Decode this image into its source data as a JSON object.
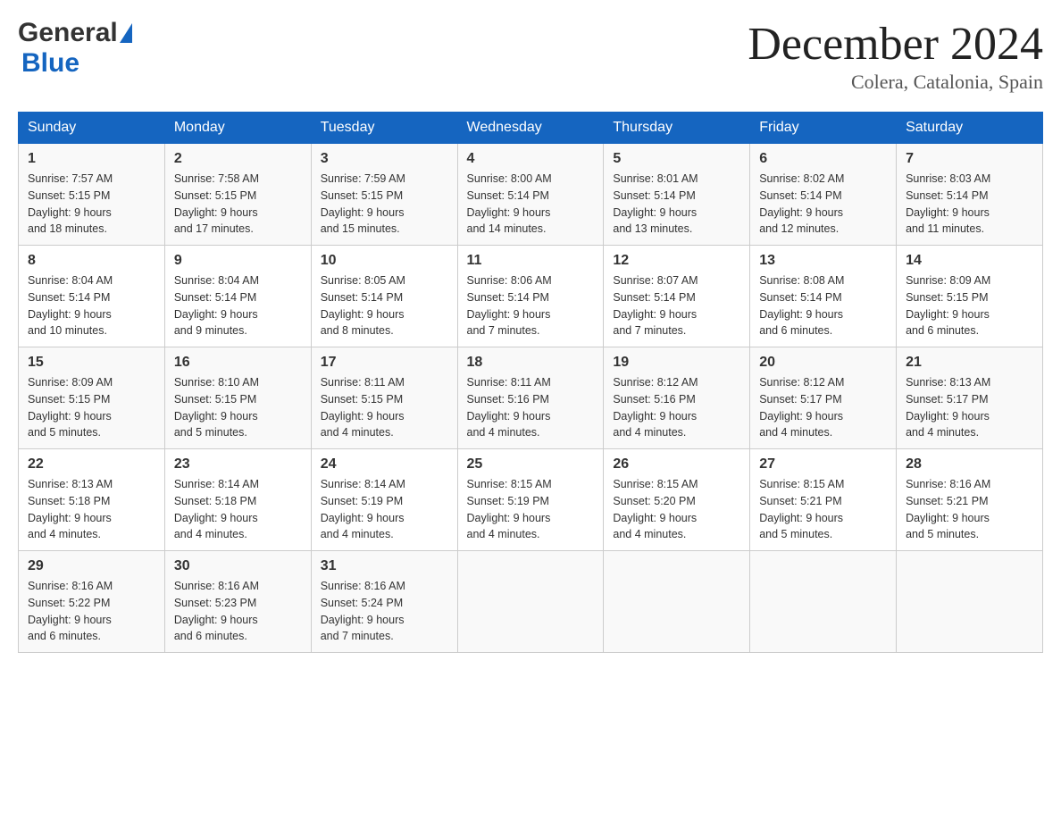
{
  "header": {
    "month_year": "December 2024",
    "location": "Colera, Catalonia, Spain",
    "logo_general": "General",
    "logo_blue": "Blue"
  },
  "days_of_week": [
    "Sunday",
    "Monday",
    "Tuesday",
    "Wednesday",
    "Thursday",
    "Friday",
    "Saturday"
  ],
  "weeks": [
    [
      {
        "day": "1",
        "sunrise": "7:57 AM",
        "sunset": "5:15 PM",
        "daylight": "9 hours and 18 minutes."
      },
      {
        "day": "2",
        "sunrise": "7:58 AM",
        "sunset": "5:15 PM",
        "daylight": "9 hours and 17 minutes."
      },
      {
        "day": "3",
        "sunrise": "7:59 AM",
        "sunset": "5:15 PM",
        "daylight": "9 hours and 15 minutes."
      },
      {
        "day": "4",
        "sunrise": "8:00 AM",
        "sunset": "5:14 PM",
        "daylight": "9 hours and 14 minutes."
      },
      {
        "day": "5",
        "sunrise": "8:01 AM",
        "sunset": "5:14 PM",
        "daylight": "9 hours and 13 minutes."
      },
      {
        "day": "6",
        "sunrise": "8:02 AM",
        "sunset": "5:14 PM",
        "daylight": "9 hours and 12 minutes."
      },
      {
        "day": "7",
        "sunrise": "8:03 AM",
        "sunset": "5:14 PM",
        "daylight": "9 hours and 11 minutes."
      }
    ],
    [
      {
        "day": "8",
        "sunrise": "8:04 AM",
        "sunset": "5:14 PM",
        "daylight": "9 hours and 10 minutes."
      },
      {
        "day": "9",
        "sunrise": "8:04 AM",
        "sunset": "5:14 PM",
        "daylight": "9 hours and 9 minutes."
      },
      {
        "day": "10",
        "sunrise": "8:05 AM",
        "sunset": "5:14 PM",
        "daylight": "9 hours and 8 minutes."
      },
      {
        "day": "11",
        "sunrise": "8:06 AM",
        "sunset": "5:14 PM",
        "daylight": "9 hours and 7 minutes."
      },
      {
        "day": "12",
        "sunrise": "8:07 AM",
        "sunset": "5:14 PM",
        "daylight": "9 hours and 7 minutes."
      },
      {
        "day": "13",
        "sunrise": "8:08 AM",
        "sunset": "5:14 PM",
        "daylight": "9 hours and 6 minutes."
      },
      {
        "day": "14",
        "sunrise": "8:09 AM",
        "sunset": "5:15 PM",
        "daylight": "9 hours and 6 minutes."
      }
    ],
    [
      {
        "day": "15",
        "sunrise": "8:09 AM",
        "sunset": "5:15 PM",
        "daylight": "9 hours and 5 minutes."
      },
      {
        "day": "16",
        "sunrise": "8:10 AM",
        "sunset": "5:15 PM",
        "daylight": "9 hours and 5 minutes."
      },
      {
        "day": "17",
        "sunrise": "8:11 AM",
        "sunset": "5:15 PM",
        "daylight": "9 hours and 4 minutes."
      },
      {
        "day": "18",
        "sunrise": "8:11 AM",
        "sunset": "5:16 PM",
        "daylight": "9 hours and 4 minutes."
      },
      {
        "day": "19",
        "sunrise": "8:12 AM",
        "sunset": "5:16 PM",
        "daylight": "9 hours and 4 minutes."
      },
      {
        "day": "20",
        "sunrise": "8:12 AM",
        "sunset": "5:17 PM",
        "daylight": "9 hours and 4 minutes."
      },
      {
        "day": "21",
        "sunrise": "8:13 AM",
        "sunset": "5:17 PM",
        "daylight": "9 hours and 4 minutes."
      }
    ],
    [
      {
        "day": "22",
        "sunrise": "8:13 AM",
        "sunset": "5:18 PM",
        "daylight": "9 hours and 4 minutes."
      },
      {
        "day": "23",
        "sunrise": "8:14 AM",
        "sunset": "5:18 PM",
        "daylight": "9 hours and 4 minutes."
      },
      {
        "day": "24",
        "sunrise": "8:14 AM",
        "sunset": "5:19 PM",
        "daylight": "9 hours and 4 minutes."
      },
      {
        "day": "25",
        "sunrise": "8:15 AM",
        "sunset": "5:19 PM",
        "daylight": "9 hours and 4 minutes."
      },
      {
        "day": "26",
        "sunrise": "8:15 AM",
        "sunset": "5:20 PM",
        "daylight": "9 hours and 4 minutes."
      },
      {
        "day": "27",
        "sunrise": "8:15 AM",
        "sunset": "5:21 PM",
        "daylight": "9 hours and 5 minutes."
      },
      {
        "day": "28",
        "sunrise": "8:16 AM",
        "sunset": "5:21 PM",
        "daylight": "9 hours and 5 minutes."
      }
    ],
    [
      {
        "day": "29",
        "sunrise": "8:16 AM",
        "sunset": "5:22 PM",
        "daylight": "9 hours and 6 minutes."
      },
      {
        "day": "30",
        "sunrise": "8:16 AM",
        "sunset": "5:23 PM",
        "daylight": "9 hours and 6 minutes."
      },
      {
        "day": "31",
        "sunrise": "8:16 AM",
        "sunset": "5:24 PM",
        "daylight": "9 hours and 7 minutes."
      },
      null,
      null,
      null,
      null
    ]
  ],
  "labels": {
    "sunrise": "Sunrise:",
    "sunset": "Sunset:",
    "daylight": "Daylight:"
  }
}
